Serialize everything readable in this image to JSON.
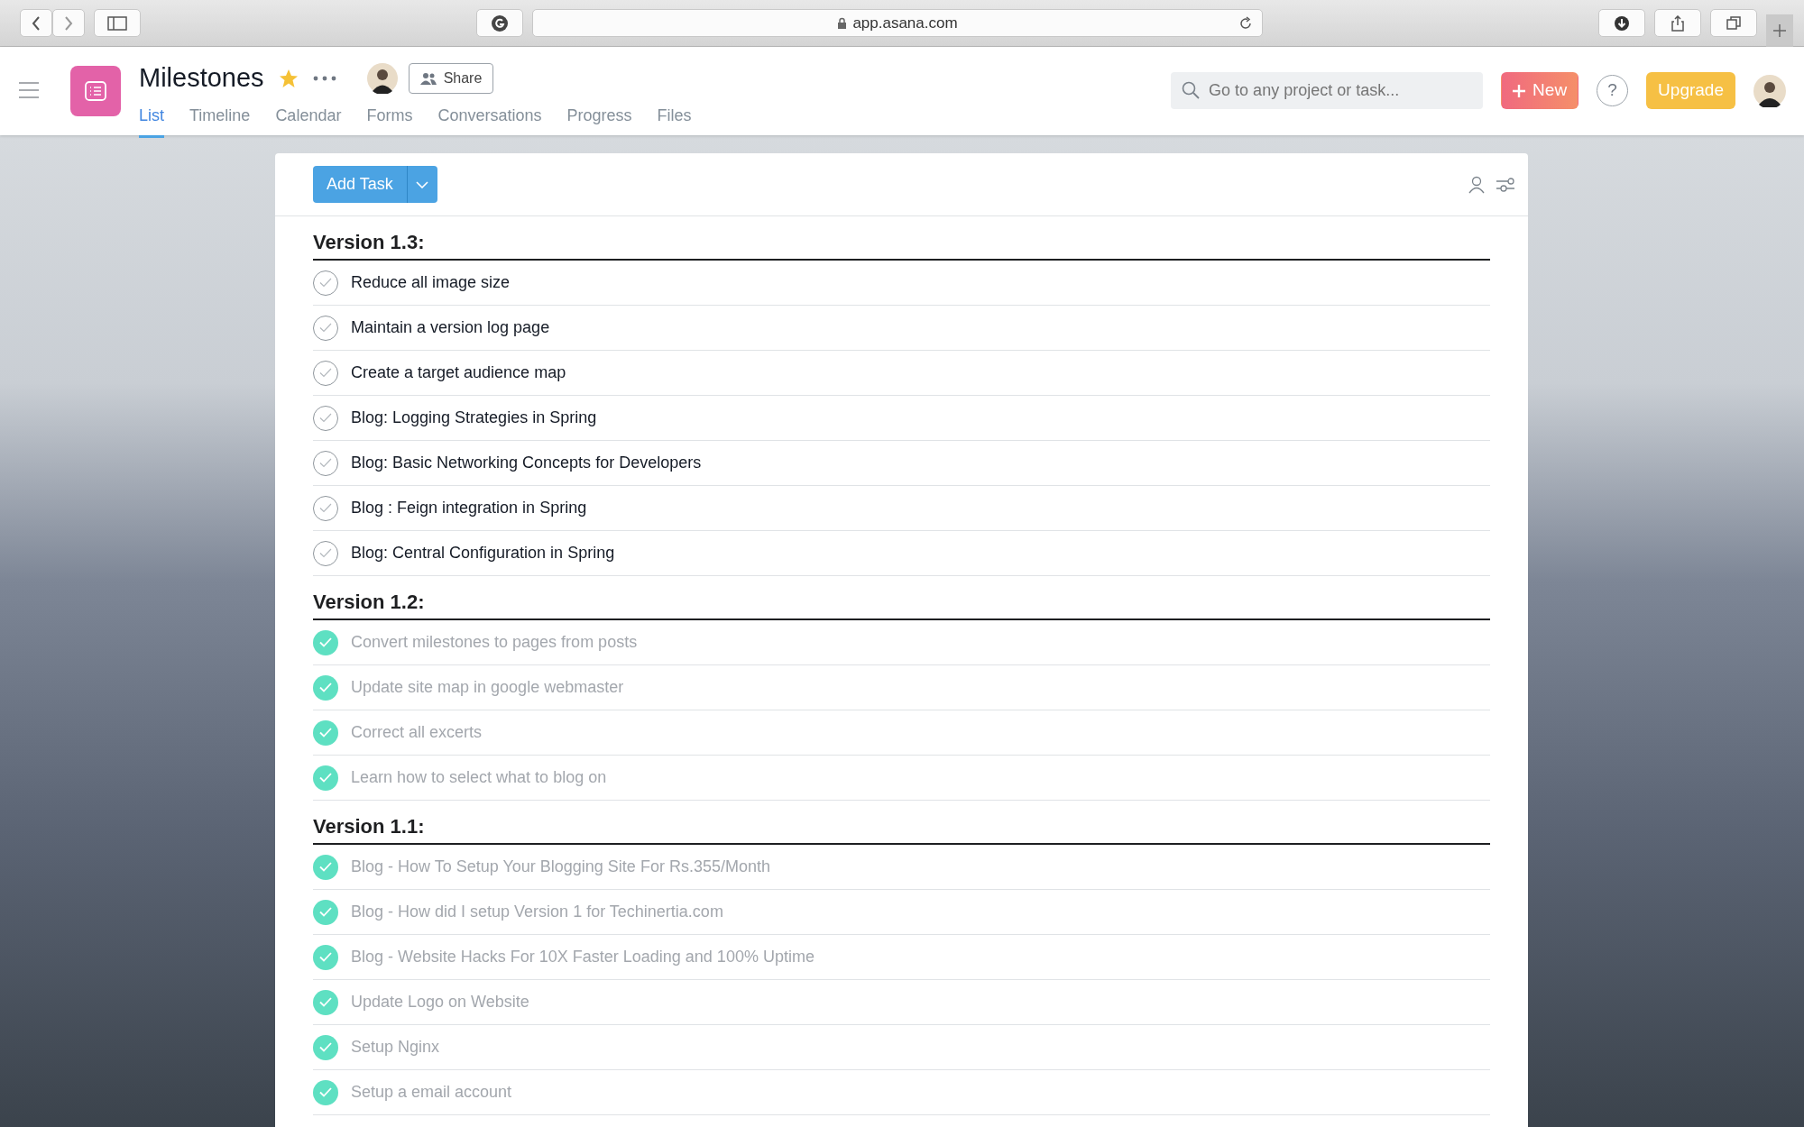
{
  "browser": {
    "url": "app.asana.com"
  },
  "project": {
    "title": "Milestones",
    "starred": true,
    "share_label": "Share"
  },
  "tabs": [
    {
      "label": "List",
      "selected": true
    },
    {
      "label": "Timeline",
      "selected": false
    },
    {
      "label": "Calendar",
      "selected": false
    },
    {
      "label": "Forms",
      "selected": false
    },
    {
      "label": "Conversations",
      "selected": false
    },
    {
      "label": "Progress",
      "selected": false
    },
    {
      "label": "Files",
      "selected": false
    }
  ],
  "search": {
    "placeholder": "Go to any project or task..."
  },
  "new_button": "New",
  "help_button": "?",
  "upgrade_button": "Upgrade",
  "add_task": "Add Task",
  "sections": [
    {
      "title": "Version 1.3:",
      "tasks": [
        {
          "name": "Reduce all image size",
          "completed": false
        },
        {
          "name": "Maintain a version log page",
          "completed": false
        },
        {
          "name": "Create a target audience map",
          "completed": false
        },
        {
          "name": "Blog: Logging Strategies in Spring",
          "completed": false
        },
        {
          "name": "Blog: Basic Networking Concepts for Developers",
          "completed": false
        },
        {
          "name": "Blog : Feign integration in Spring",
          "completed": false
        },
        {
          "name": "Blog: Central Configuration in Spring",
          "completed": false
        }
      ]
    },
    {
      "title": "Version 1.2:",
      "tasks": [
        {
          "name": "Convert milestones to pages from posts",
          "completed": true
        },
        {
          "name": "Update site map in google webmaster",
          "completed": true
        },
        {
          "name": "Correct all excerts",
          "completed": true
        },
        {
          "name": "Learn how to select what to blog on",
          "completed": true
        }
      ]
    },
    {
      "title": "Version 1.1:",
      "tasks": [
        {
          "name": "Blog - How To Setup Your Blogging Site For Rs.355/Month",
          "completed": true
        },
        {
          "name": "Blog - How did I setup Version 1 for Techinertia.com",
          "completed": true
        },
        {
          "name": "Blog - Website Hacks For 10X Faster Loading and 100% Uptime",
          "completed": true
        },
        {
          "name": "Update Logo on Website",
          "completed": true
        },
        {
          "name": "Setup Nginx",
          "completed": true
        },
        {
          "name": "Setup a email account",
          "completed": true
        }
      ]
    }
  ]
}
